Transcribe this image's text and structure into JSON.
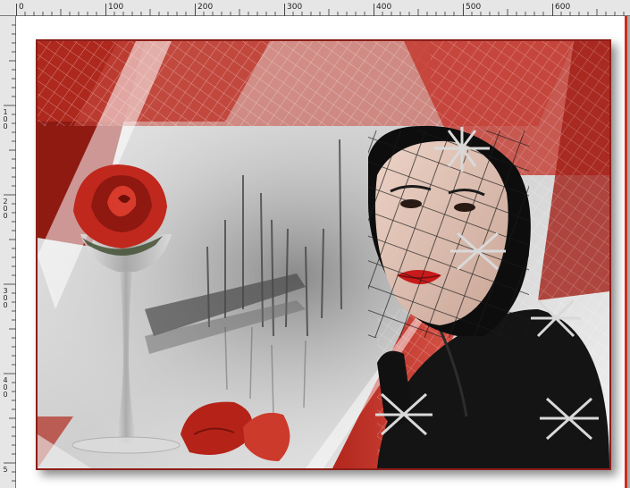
{
  "ruler": {
    "top_labels": [
      "0",
      "100",
      "200",
      "300",
      "400",
      "500",
      "600"
    ],
    "left_labels": [
      "1\n0\n0",
      "2\n0\n0",
      "3\n0\n0",
      "4\n0\n0",
      "5"
    ]
  },
  "colors": {
    "ruler_bg": "#e6e6e6",
    "canvas_bg": "#ffffff",
    "accent_red": "#cf2a1f",
    "frame_border": "#8c1f18"
  },
  "artwork": {
    "elements": [
      "red-rose-icon",
      "glass-vase",
      "rose-petals",
      "misty-pier",
      "woman-portrait",
      "net-veil",
      "spider-brooch-icon"
    ]
  }
}
